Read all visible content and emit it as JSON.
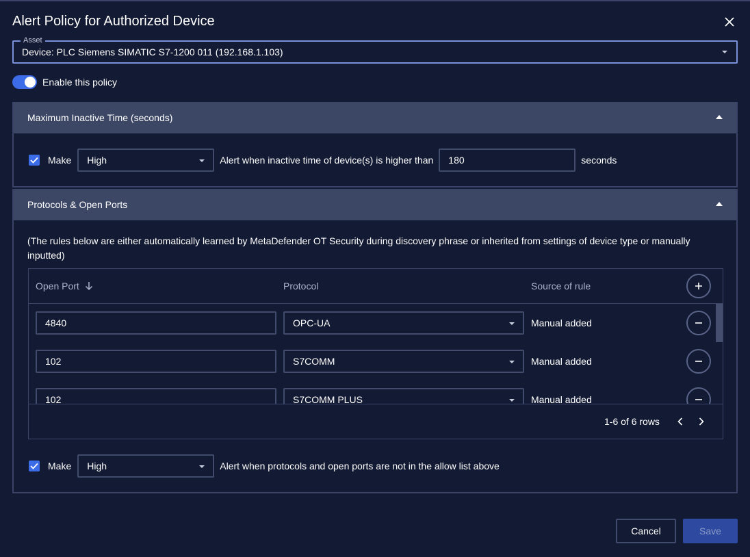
{
  "dialog": {
    "title": "Alert Policy for Authorized Device"
  },
  "asset": {
    "legend": "Asset",
    "value": "Device: PLC Siemens SIMATIC S7-1200 011 (192.168.1.103)"
  },
  "enable_policy": {
    "label": "Enable this policy",
    "checked": true
  },
  "inactive_section": {
    "title": "Maximum Inactive Time (seconds)",
    "make_checked": true,
    "make_label": "Make",
    "severity": "High",
    "alert_text": "Alert when inactive time of device(s) is higher than",
    "threshold": "180",
    "unit": "seconds"
  },
  "ports_section": {
    "title": "Protocols & Open Ports",
    "info": "(The rules below are either automatically learned by MetaDefender OT Security during discovery phrase or inherited from settings of device type or manually inputted)",
    "columns": {
      "port": "Open Port",
      "protocol": "Protocol",
      "source": "Source of rule"
    },
    "rows": [
      {
        "port": "4840",
        "protocol": "OPC-UA",
        "source": "Manual added"
      },
      {
        "port": "102",
        "protocol": "S7COMM",
        "source": "Manual added"
      },
      {
        "port": "102",
        "protocol": "S7COMM PLUS",
        "source": "Manual added"
      }
    ],
    "pagination": "1-6 of 6 rows",
    "make_checked": true,
    "make_label": "Make",
    "severity": "High",
    "alert_text": "Alert when protocols and open ports are not in the allow list above"
  },
  "buttons": {
    "cancel": "Cancel",
    "save": "Save"
  },
  "colors": {
    "background": "#131a33",
    "section_header": "#3c4665",
    "accent": "#3d6ce8",
    "save_disabled": "#2d4aa0"
  }
}
